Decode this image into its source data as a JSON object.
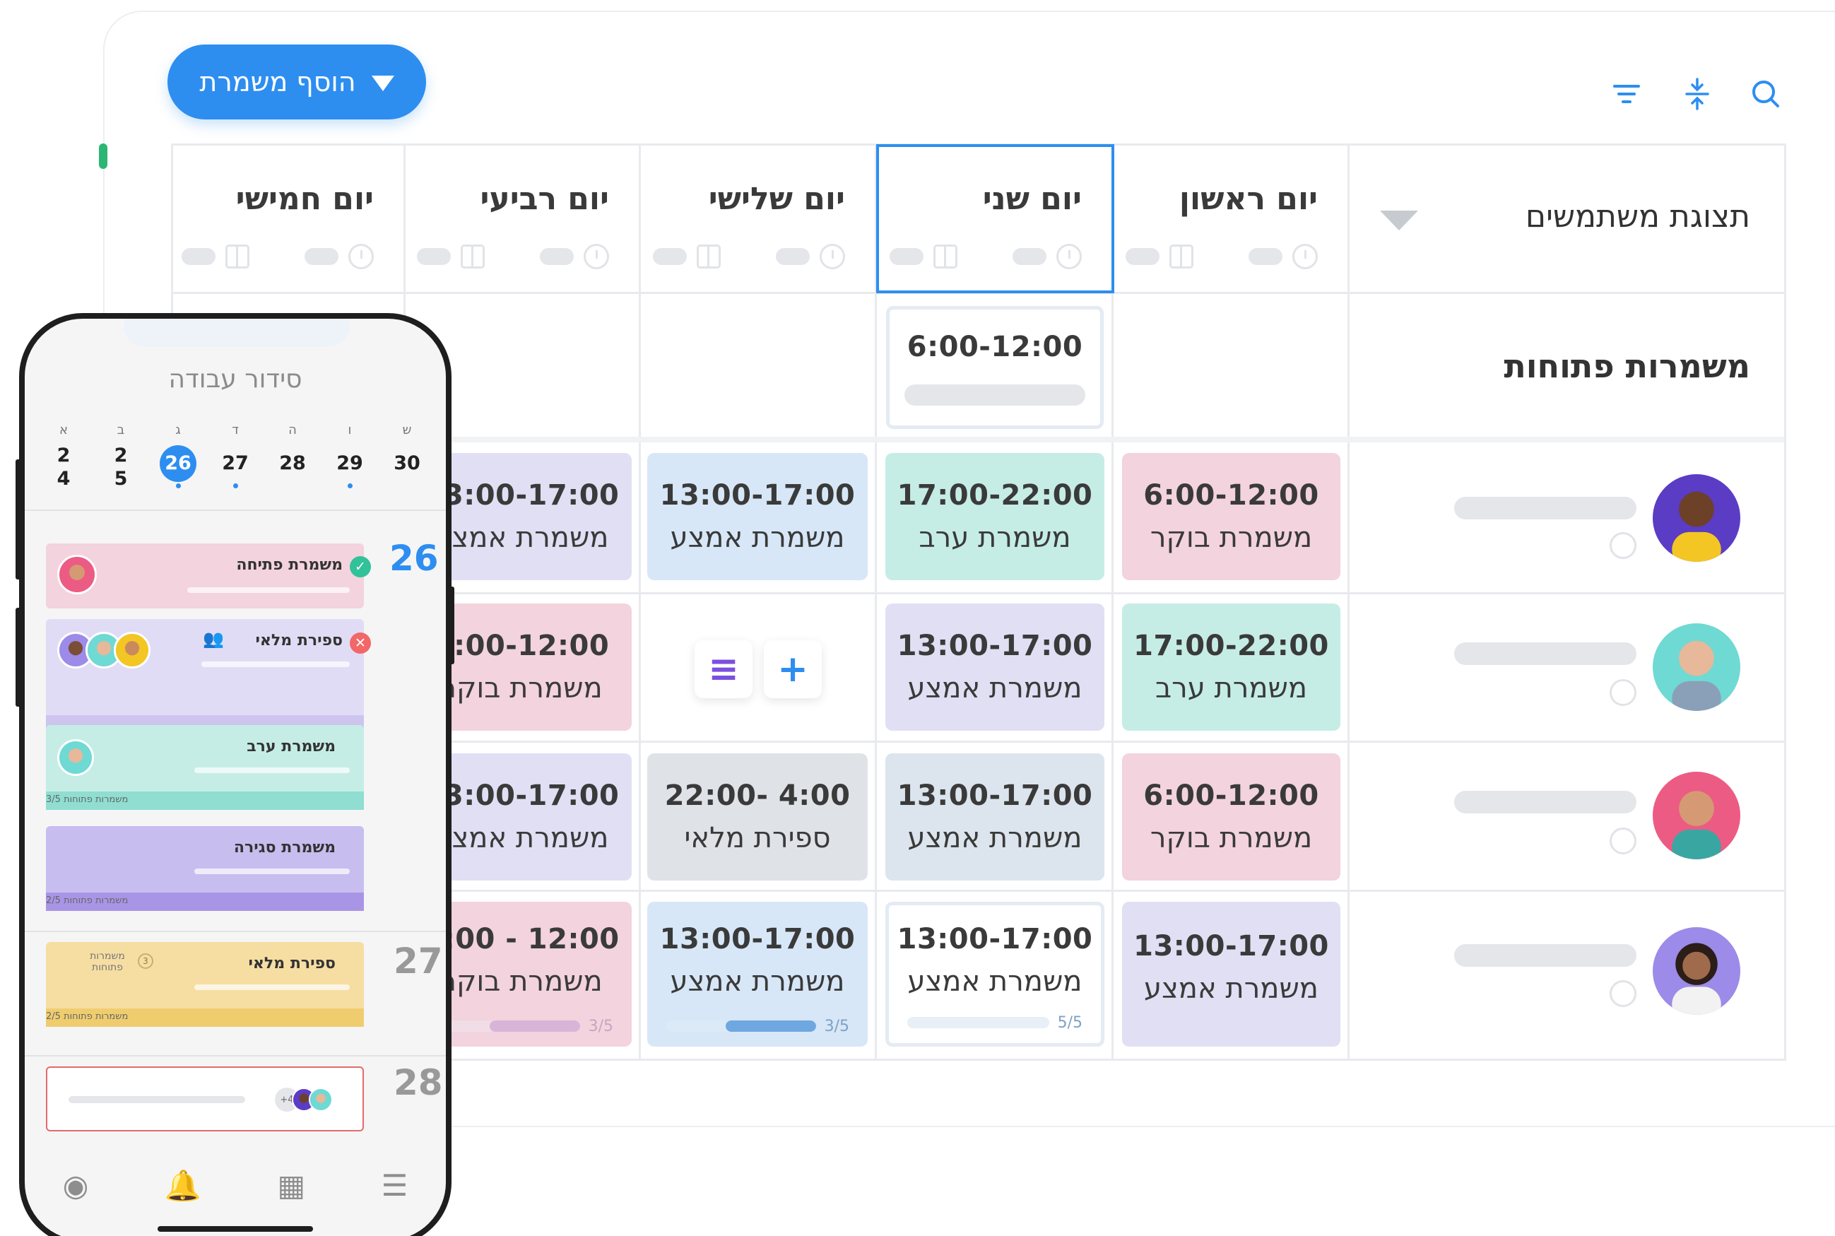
{
  "toolbar": {
    "add_shift_label": "הוסף משמרת",
    "search_icon": "search-icon",
    "collapse_icon": "collapse-icon",
    "filter_icon": "filter-icon"
  },
  "header": {
    "users_view_label": "תצוגת משתמשים",
    "days": [
      "יום ראשון",
      "יום שני",
      "יום שלישי",
      "יום רביעי",
      "יום חמישי"
    ]
  },
  "open_shifts": {
    "label": "משמרות פתוחות",
    "monday": "6:00-12:00"
  },
  "rows": [
    {
      "cells": [
        {
          "time": "6:00-12:00",
          "name": "משמרת בוקר"
        },
        {
          "time": "17:00-22:00",
          "name": "משמרת ערב"
        },
        {
          "time": "13:00-17:00",
          "name": "משמרת אמצע"
        },
        {
          "time": "13:00-17:00",
          "name": "משמרת אמצע"
        }
      ]
    },
    {
      "cells": [
        {
          "time": "17:00-22:00",
          "name": "משמרת ערב"
        },
        {
          "time": "13:00-17:00",
          "name": "משמרת אמצע"
        },
        {
          "time": "",
          "name": ""
        },
        {
          "time": "6:00-12:00",
          "name": "משמרת בוקר"
        }
      ]
    },
    {
      "cells": [
        {
          "time": "6:00-12:00",
          "name": "משמרת בוקר"
        },
        {
          "time": "13:00-17:00",
          "name": "משמרת אמצע"
        },
        {
          "time": "22:00- 4:00",
          "name": "ספירת מלאי"
        },
        {
          "time": "13:00-17:00",
          "name": "משמרת אמצע"
        }
      ]
    },
    {
      "cells": [
        {
          "time": "13:00-17:00",
          "name": "משמרת אמצע"
        },
        {
          "time": "13:00-17:00",
          "name": "משמרת אמצע",
          "progress": "5/5",
          "fill": 1.0
        },
        {
          "time": "13:00-17:00",
          "name": "משמרת אמצע",
          "progress": "3/5",
          "fill": 0.6
        },
        {
          "time": "8:00 - 12:00",
          "name": "משמרת בוקר",
          "progress": "3/5",
          "fill": 0.6
        }
      ]
    }
  ],
  "cell_actions": {
    "list_icon": "≡",
    "add_icon": "+"
  },
  "phone": {
    "title": "סידור עבודה",
    "week": [
      {
        "letter": "ש",
        "date": "30",
        "dot": false
      },
      {
        "letter": "ו",
        "date": "29",
        "dot": true
      },
      {
        "letter": "ה",
        "date": "28",
        "dot": false
      },
      {
        "letter": "ד",
        "date": "27",
        "dot": true
      },
      {
        "letter": "ג",
        "date": "26",
        "dot": true,
        "selected": true
      },
      {
        "letter": "ב",
        "date": "2",
        "sub": "5",
        "dot": false
      },
      {
        "letter": "א",
        "date": "2",
        "sub": "4",
        "dot": false
      }
    ],
    "dates": [
      "26",
      "27",
      "28"
    ],
    "cards": [
      {
        "title": "משמרת פתיחה"
      },
      {
        "title": "ספירת מלאי"
      },
      {
        "title": "משמרת ערב",
        "footer": "3/5 משמרות פתוחות"
      },
      {
        "title": "משמרת סגירה",
        "footer": "2/5 משמרות פתוחות"
      },
      {
        "title": "ספירת מלאי",
        "badge_label": "משמרות פתוחות",
        "badge_count": "3",
        "footer": "2/5 משמרות פתוחות"
      }
    ],
    "extra_count": "+4",
    "nav_icons": [
      "profile-icon",
      "bell-icon",
      "grid-icon",
      "menu-icon"
    ]
  },
  "colors": {
    "accent": "#2d8ef0",
    "pink": "#f3d3dd",
    "teal": "#c5ede5",
    "blue": "#d7e7f7",
    "lavender": "#e1dff4"
  }
}
